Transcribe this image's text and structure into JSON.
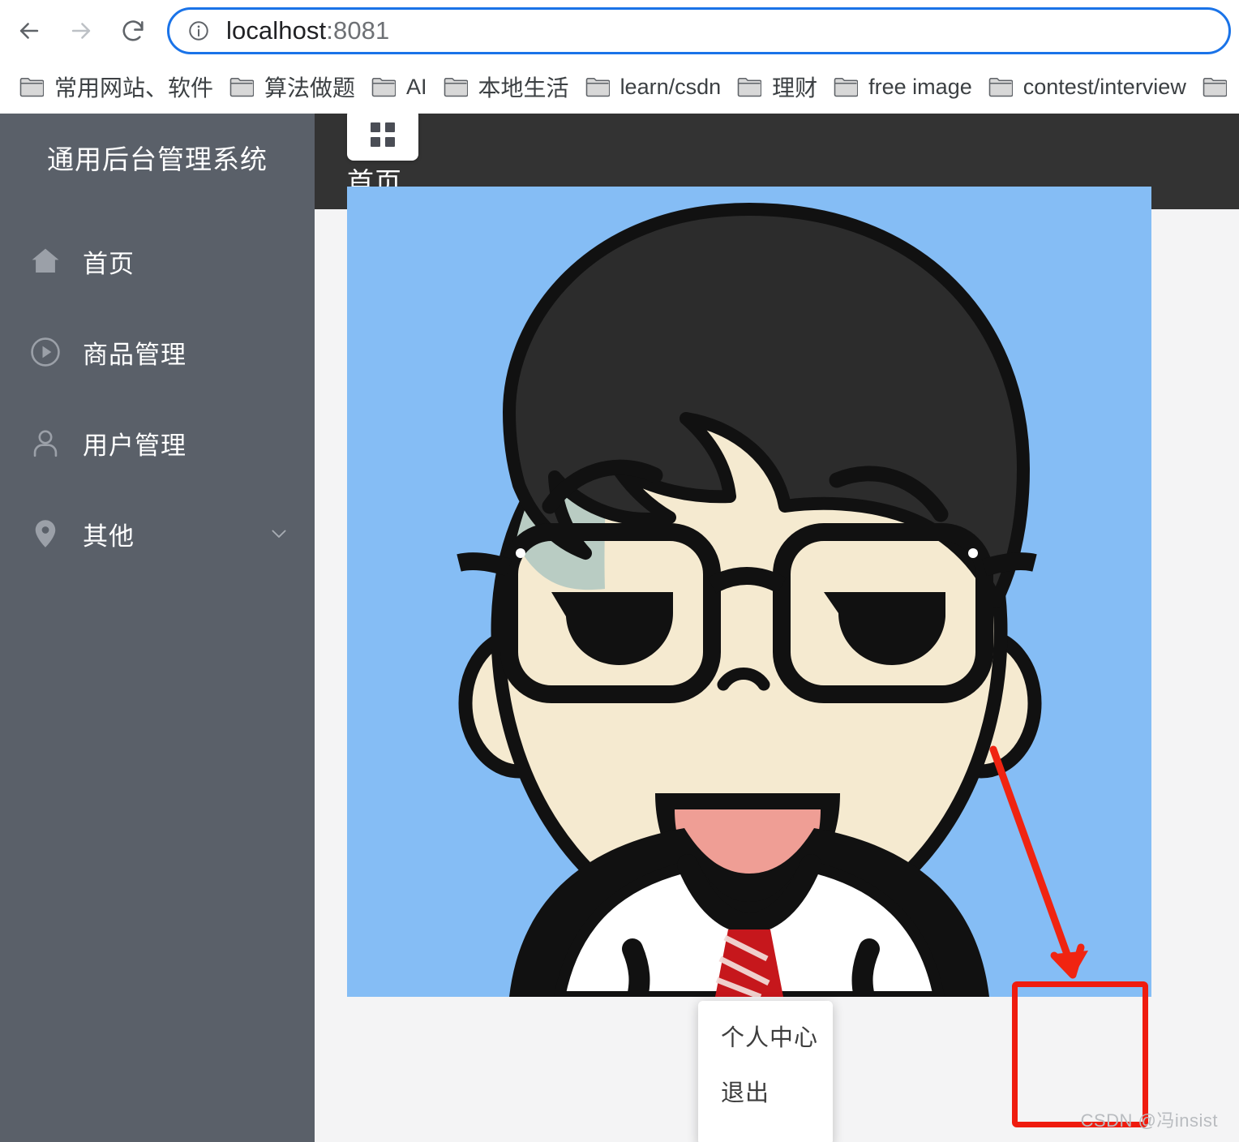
{
  "browser": {
    "back_label": "Back",
    "forward_label": "Forward",
    "reload_label": "Reload",
    "url_host": "localhost",
    "url_port": ":8081",
    "url_full": "localhost:8081",
    "site_info_icon": "info-circle-icon",
    "bookmarks": [
      {
        "label": "常用网站、软件",
        "icon": "folder-icon"
      },
      {
        "label": "算法做题",
        "icon": "folder-icon"
      },
      {
        "label": "AI",
        "icon": "folder-icon"
      },
      {
        "label": "本地生活",
        "icon": "folder-icon"
      },
      {
        "label": "learn/csdn",
        "icon": "folder-icon"
      },
      {
        "label": "理财",
        "icon": "folder-icon"
      },
      {
        "label": "free image",
        "icon": "folder-icon"
      },
      {
        "label": "contest/interview",
        "icon": "folder-icon"
      }
    ]
  },
  "sidebar": {
    "title": "通用后台管理系统",
    "bg_color": "#5a6069",
    "items": [
      {
        "label": "首页",
        "icon": "home-icon",
        "has_chevron": false
      },
      {
        "label": "商品管理",
        "icon": "play-circle-icon",
        "has_chevron": false
      },
      {
        "label": "用户管理",
        "icon": "user-icon",
        "has_chevron": false
      },
      {
        "label": "其他",
        "icon": "location-pin-icon",
        "has_chevron": true
      }
    ]
  },
  "header": {
    "bg_color": "#333333",
    "toggle_icon": "grid-menu-icon",
    "breadcrumb": "首页"
  },
  "content": {
    "avatar_alt": "cartoon-avatar-boy-with-glasses",
    "avatar_bg_color": "#85bdf5",
    "page_bg_color": "#f4f4f5"
  },
  "user_dropdown": {
    "items": [
      {
        "label": "个人中心"
      },
      {
        "label": "退出"
      }
    ]
  },
  "annotations": {
    "highlight_color": "#ef1c0f",
    "arrow_icon": "red-arrow-down-icon",
    "box_icon": "red-highlight-box"
  },
  "watermark": {
    "text": "CSDN @冯insist"
  }
}
